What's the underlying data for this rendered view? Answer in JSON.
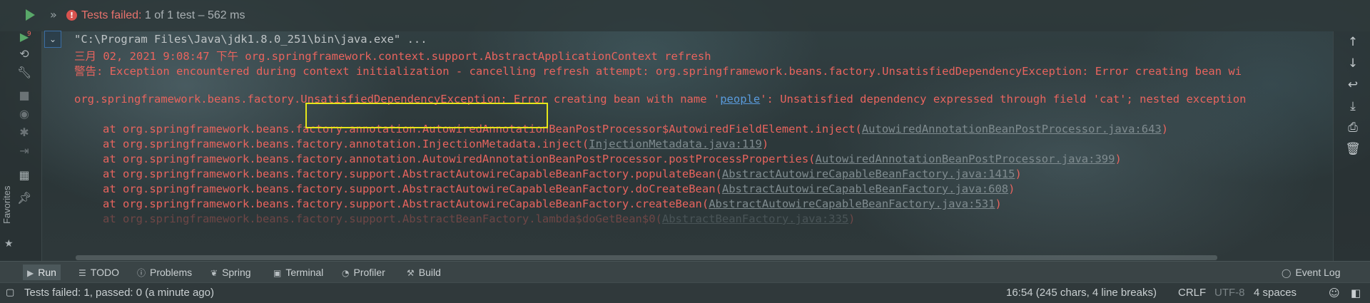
{
  "run_header": {
    "status_strong": "Tests failed:",
    "status_rest": " 1 of 1 test – 562 ms"
  },
  "console": {
    "lines": [
      "\"C:\\Program Files\\Java\\jdk1.8.0_251\\bin\\java.exe\" ...",
      "三月 02, 2021 9:08:47 下午 org.springframework.context.support.AbstractApplicationContext refresh",
      "警告: Exception encountered during context initialization - cancelling refresh attempt: org.springframework.beans.factory.UnsatisfiedDependencyException: Error creating bean wi",
      ""
    ],
    "exception_line": {
      "prefix": "org.springframework.beans.factory.",
      "exception": "UnsatisfiedDependencyException:",
      "mid": " Error creating bean with name '",
      "bean": "people",
      "suffix": "': Unsatisfied dependency expressed through field 'cat'; nested exception"
    },
    "stack": [
      {
        "text": "at org.springframework.beans.factory.annotation.AutowiredAnnotationBeanPostProcessor$AutowiredFieldElement.inject(",
        "link": "AutowiredAnnotationBeanPostProcessor.java:643",
        "close": ")"
      },
      {
        "text": "at org.springframework.beans.factory.annotation.InjectionMetadata.inject(",
        "link": "InjectionMetadata.java:119",
        "close": ")"
      },
      {
        "text": "at org.springframework.beans.factory.annotation.AutowiredAnnotationBeanPostProcessor.postProcessProperties(",
        "link": "AutowiredAnnotationBeanPostProcessor.java:399",
        "close": ")"
      },
      {
        "text": "at org.springframework.beans.factory.support.AbstractAutowireCapableBeanFactory.populateBean(",
        "link": "AbstractAutowireCapableBeanFactory.java:1415",
        "close": ")"
      },
      {
        "text": "at org.springframework.beans.factory.support.AbstractAutowireCapableBeanFactory.doCreateBean(",
        "link": "AbstractAutowireCapableBeanFactory.java:608",
        "close": ")"
      },
      {
        "text": "at org.springframework.beans.factory.support.AbstractAutowireCapableBeanFactory.createBean(",
        "link": "AbstractAutowireCapableBeanFactory.java:531",
        "close": ")"
      },
      {
        "text": "at org.springframework.beans.factory.support.AbstractBeanFactory.lambda$doGetBean$0(",
        "link": "AbstractBeanFactory.java:335",
        "close": ")"
      }
    ]
  },
  "left_toolbar": {
    "favorites_label": "Favorites",
    "rerun_badge": "9"
  },
  "bottom_tabs": [
    {
      "label": "Run",
      "icon": "play-icon"
    },
    {
      "label": "TODO",
      "icon": "list-icon"
    },
    {
      "label": "Problems",
      "icon": "info-icon"
    },
    {
      "label": "Spring",
      "icon": "leaf-icon"
    },
    {
      "label": "Terminal",
      "icon": "terminal-icon"
    },
    {
      "label": "Profiler",
      "icon": "profiler-icon"
    },
    {
      "label": "Build",
      "icon": "hammer-icon"
    }
  ],
  "event_log": "Event Log",
  "status_bar": {
    "message": "Tests failed: 1, passed: 0 (a minute ago)",
    "position": "16:54 (245 chars, 4 line breaks)",
    "line_sep": "CRLF",
    "encoding": "UTF-8",
    "indent": "4 spaces"
  },
  "colors": {
    "error": "#e8645e",
    "link": "#7f8b8f",
    "bean_link": "#5a9bdc",
    "highlight": "#e6e61a"
  }
}
